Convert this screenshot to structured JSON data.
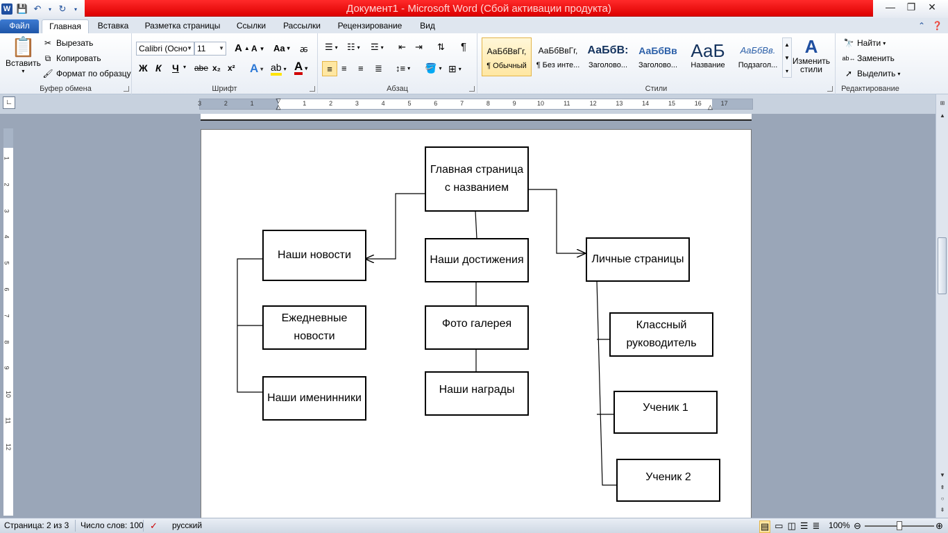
{
  "window": {
    "title": "Документ1  -  Microsoft Word (Сбой активации продукта)",
    "app_icon": "W"
  },
  "tabs": {
    "file": "Файл",
    "items": [
      "Главная",
      "Вставка",
      "Разметка страницы",
      "Ссылки",
      "Рассылки",
      "Рецензирование",
      "Вид"
    ],
    "active": "Главная"
  },
  "ribbon": {
    "clipboard": {
      "label": "Буфер обмена",
      "paste": "Вставить",
      "cut": "Вырезать",
      "copy": "Копировать",
      "format_painter": "Формат по образцу"
    },
    "font": {
      "label": "Шрифт",
      "font_name": "Calibri (Осно",
      "font_size": "11",
      "bold": "Ж",
      "italic": "К",
      "underline": "Ч",
      "strike": "abe",
      "subscript": "x₂",
      "superscript": "x²",
      "grow": "A",
      "shrink": "A",
      "case": "Aa"
    },
    "paragraph": {
      "label": "Абзац"
    },
    "styles": {
      "label": "Стили",
      "items": [
        {
          "preview": "АаБбВвГг,",
          "name": "¶ Обычный"
        },
        {
          "preview": "АаБбВвГг,",
          "name": "¶ Без инте..."
        },
        {
          "preview": "АаБбВ:",
          "name": "Заголово..."
        },
        {
          "preview": "АаБбВв",
          "name": "Заголово..."
        },
        {
          "preview": "АаБ",
          "name": "Название"
        },
        {
          "preview": "АаБбВв.",
          "name": "Подзагол..."
        }
      ],
      "change_styles": "Изменить стили"
    },
    "editing": {
      "label": "Редактирование",
      "find": "Найти",
      "replace": "Заменить",
      "select": "Выделить"
    }
  },
  "ruler": {
    "ticks": [
      "3",
      "2",
      "1",
      "1",
      "2",
      "3",
      "4",
      "5",
      "6",
      "7",
      "8",
      "9",
      "10",
      "11",
      "12",
      "13",
      "14",
      "15",
      "16",
      "17"
    ],
    "vticks": [
      "1",
      "2",
      "3",
      "4",
      "5",
      "6",
      "7",
      "8",
      "9",
      "10",
      "11",
      "12"
    ]
  },
  "diagram": {
    "nodes": {
      "main": "Главная страница с названием",
      "news": "Наши новости",
      "daily_news": "Ежедневные новости",
      "birthdays": "Наши именинники",
      "achievements": "Наши достижения",
      "gallery": "Фото галерея",
      "awards": "Наши награды",
      "personal": "Личные страницы",
      "teacher": "Классный руководитель",
      "student1": "Ученик 1",
      "student2": "Ученик 2"
    }
  },
  "status": {
    "page": "Страница: 2 из 3",
    "words": "Число слов: 100",
    "language": "русский",
    "zoom": "100%",
    "zoom_level": 100
  }
}
